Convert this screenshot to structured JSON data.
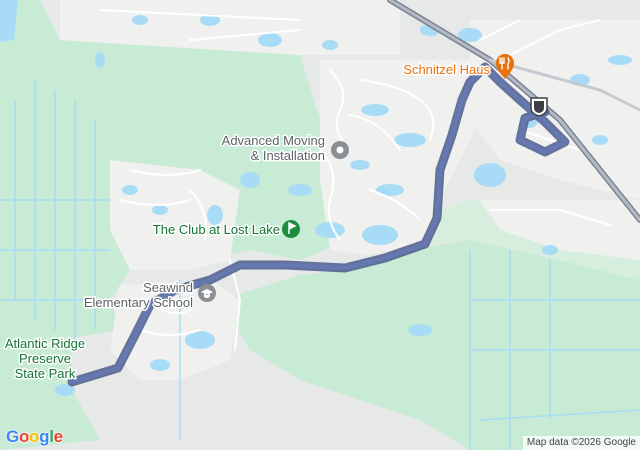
{
  "map": {
    "colors": {
      "water": "#a8dcf6",
      "land": "#e6e9e7",
      "park": "#c8ebd6",
      "route": "#4c5c8c",
      "road": "#ffffff",
      "highway": "#7a8493",
      "poi_gray": "#5f6368",
      "poi_food": "#e8710a",
      "poi_green": "#137333"
    },
    "pois": [
      {
        "id": "schnitzel",
        "lines": [
          "Schnitzel Haus"
        ],
        "icon": "fork-knife-icon",
        "category": "food"
      },
      {
        "id": "advanced",
        "lines": [
          "Advanced Moving",
          "& Installation"
        ],
        "icon": "map-pin-icon",
        "category": "business"
      },
      {
        "id": "club",
        "lines": [
          "The Club at Lost Lake"
        ],
        "icon": "golf-icon",
        "category": "recreation"
      },
      {
        "id": "seawind",
        "lines": [
          "Seawind",
          "Elementary School"
        ],
        "icon": "graduation-cap-icon",
        "category": "school"
      },
      {
        "id": "atlantic",
        "lines": [
          "Atlantic Ridge",
          "Preserve",
          "State Park"
        ],
        "icon": "",
        "category": "park"
      }
    ],
    "highway_shield": {
      "text": "",
      "icon": "us-highway-shield-icon"
    },
    "attribution": "Map data ©2026 Google",
    "logo": "Google"
  }
}
